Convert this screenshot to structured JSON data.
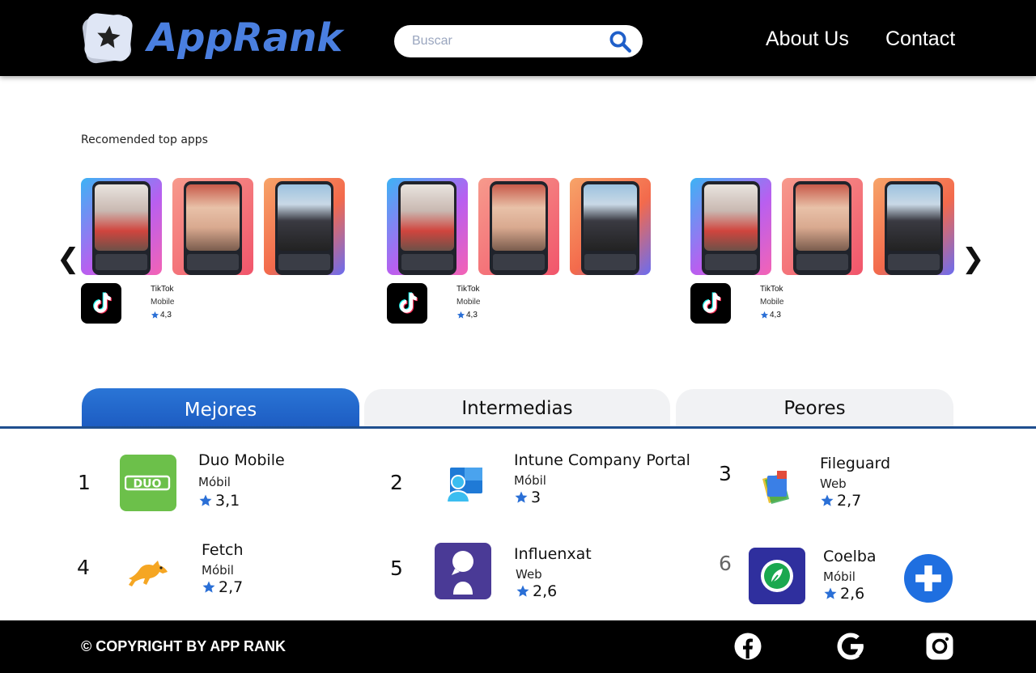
{
  "header": {
    "logo_text": "AppRank",
    "logo_icon": "star-icon",
    "search_placeholder": "Buscar",
    "search_icon": "search-icon",
    "nav": [
      "About Us",
      "Contact"
    ]
  },
  "recommended": {
    "title": "Recomended top apps",
    "prev_arrow": "❮",
    "next_arrow": "❯",
    "cards": [
      {
        "name": "TikTok",
        "category": "Mobile",
        "rating": "4,3"
      },
      {
        "name": "TikTok",
        "category": "Mobile",
        "rating": "4,3"
      },
      {
        "name": "TikTok",
        "category": "Mobile",
        "rating": "4,3"
      }
    ]
  },
  "tabs": [
    "Mejores",
    "Intermedias",
    "Peores"
  ],
  "ranking": [
    {
      "rank": "1",
      "name": "Duo Mobile",
      "category": "Móbil",
      "rating": "3,1",
      "icon": "duo-icon"
    },
    {
      "rank": "2",
      "name": "Intune Company Portal",
      "category": "Móbil",
      "rating": "3",
      "icon": "intune-icon"
    },
    {
      "rank": "3",
      "name": "Fileguard",
      "category": "Web",
      "rating": "2,7",
      "icon": "fileguard-icon"
    },
    {
      "rank": "4",
      "name": "Fetch",
      "category": "Móbil",
      "rating": "2,7",
      "icon": "fetch-dog-icon"
    },
    {
      "rank": "5",
      "name": "Influenxat",
      "category": "Web",
      "rating": "2,6",
      "icon": "influenxat-icon"
    },
    {
      "rank": "6",
      "name": "Coelba",
      "category": "Móbil",
      "rating": "2,6",
      "icon": "coelba-leaf-icon"
    }
  ],
  "footer": {
    "copyright": "© COPYRIGHT BY APP RANK",
    "social": [
      "facebook-icon",
      "google-icon",
      "instagram-icon"
    ]
  },
  "colors": {
    "accent": "#1f6fe0",
    "logo_text": "#4a7fe0",
    "duo_green": "#6cc04a",
    "influenxat_purple": "#4a3a96",
    "header_bg": "#000000"
  }
}
